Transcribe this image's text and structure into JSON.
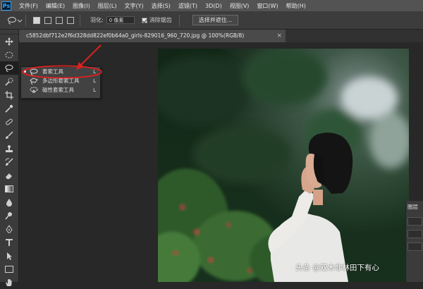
{
  "app": {
    "logo": "Ps"
  },
  "menu": [
    "文件(F)",
    "编辑(E)",
    "图像(I)",
    "图层(L)",
    "文字(Y)",
    "选择(S)",
    "滤镜(T)",
    "3D(D)",
    "视图(V)",
    "窗口(W)",
    "帮助(H)"
  ],
  "options": {
    "feather_label": "羽化:",
    "feather_value": "0 像素",
    "antialias_label": "消除锯齿",
    "antialias_checked": true,
    "select_and_mask_label": "选择并遮住..."
  },
  "document_tab": {
    "title": "c5852dbf712e2f6d328dd822ef0b64a0_girls-829016_960_720.jpg @ 100%(RGB/8)",
    "close": "×"
  },
  "flyout": {
    "items": [
      {
        "label": "套索工具",
        "shortcut": "L",
        "icon": "lasso-icon",
        "selected": true
      },
      {
        "label": "多边形套索工具",
        "shortcut": "L",
        "icon": "polygonal-lasso-icon",
        "selected": false
      },
      {
        "label": "磁性套索工具",
        "shortcut": "L",
        "icon": "magnetic-lasso-icon",
        "selected": false
      }
    ]
  },
  "panel": {
    "title": "图层"
  },
  "watermark": "头条 @双木非林田下有心",
  "annotation_color": "#e02020",
  "tools": [
    "move-icon",
    "marquee-icon",
    "lasso-icon",
    "quick-select-icon",
    "crop-icon",
    "eyedropper-icon",
    "healing-brush-icon",
    "brush-icon",
    "clone-stamp-icon",
    "history-brush-icon",
    "eraser-icon",
    "gradient-icon",
    "blur-icon",
    "dodge-icon",
    "pen-icon",
    "type-icon",
    "path-select-icon",
    "rectangle-icon",
    "hand-icon"
  ]
}
